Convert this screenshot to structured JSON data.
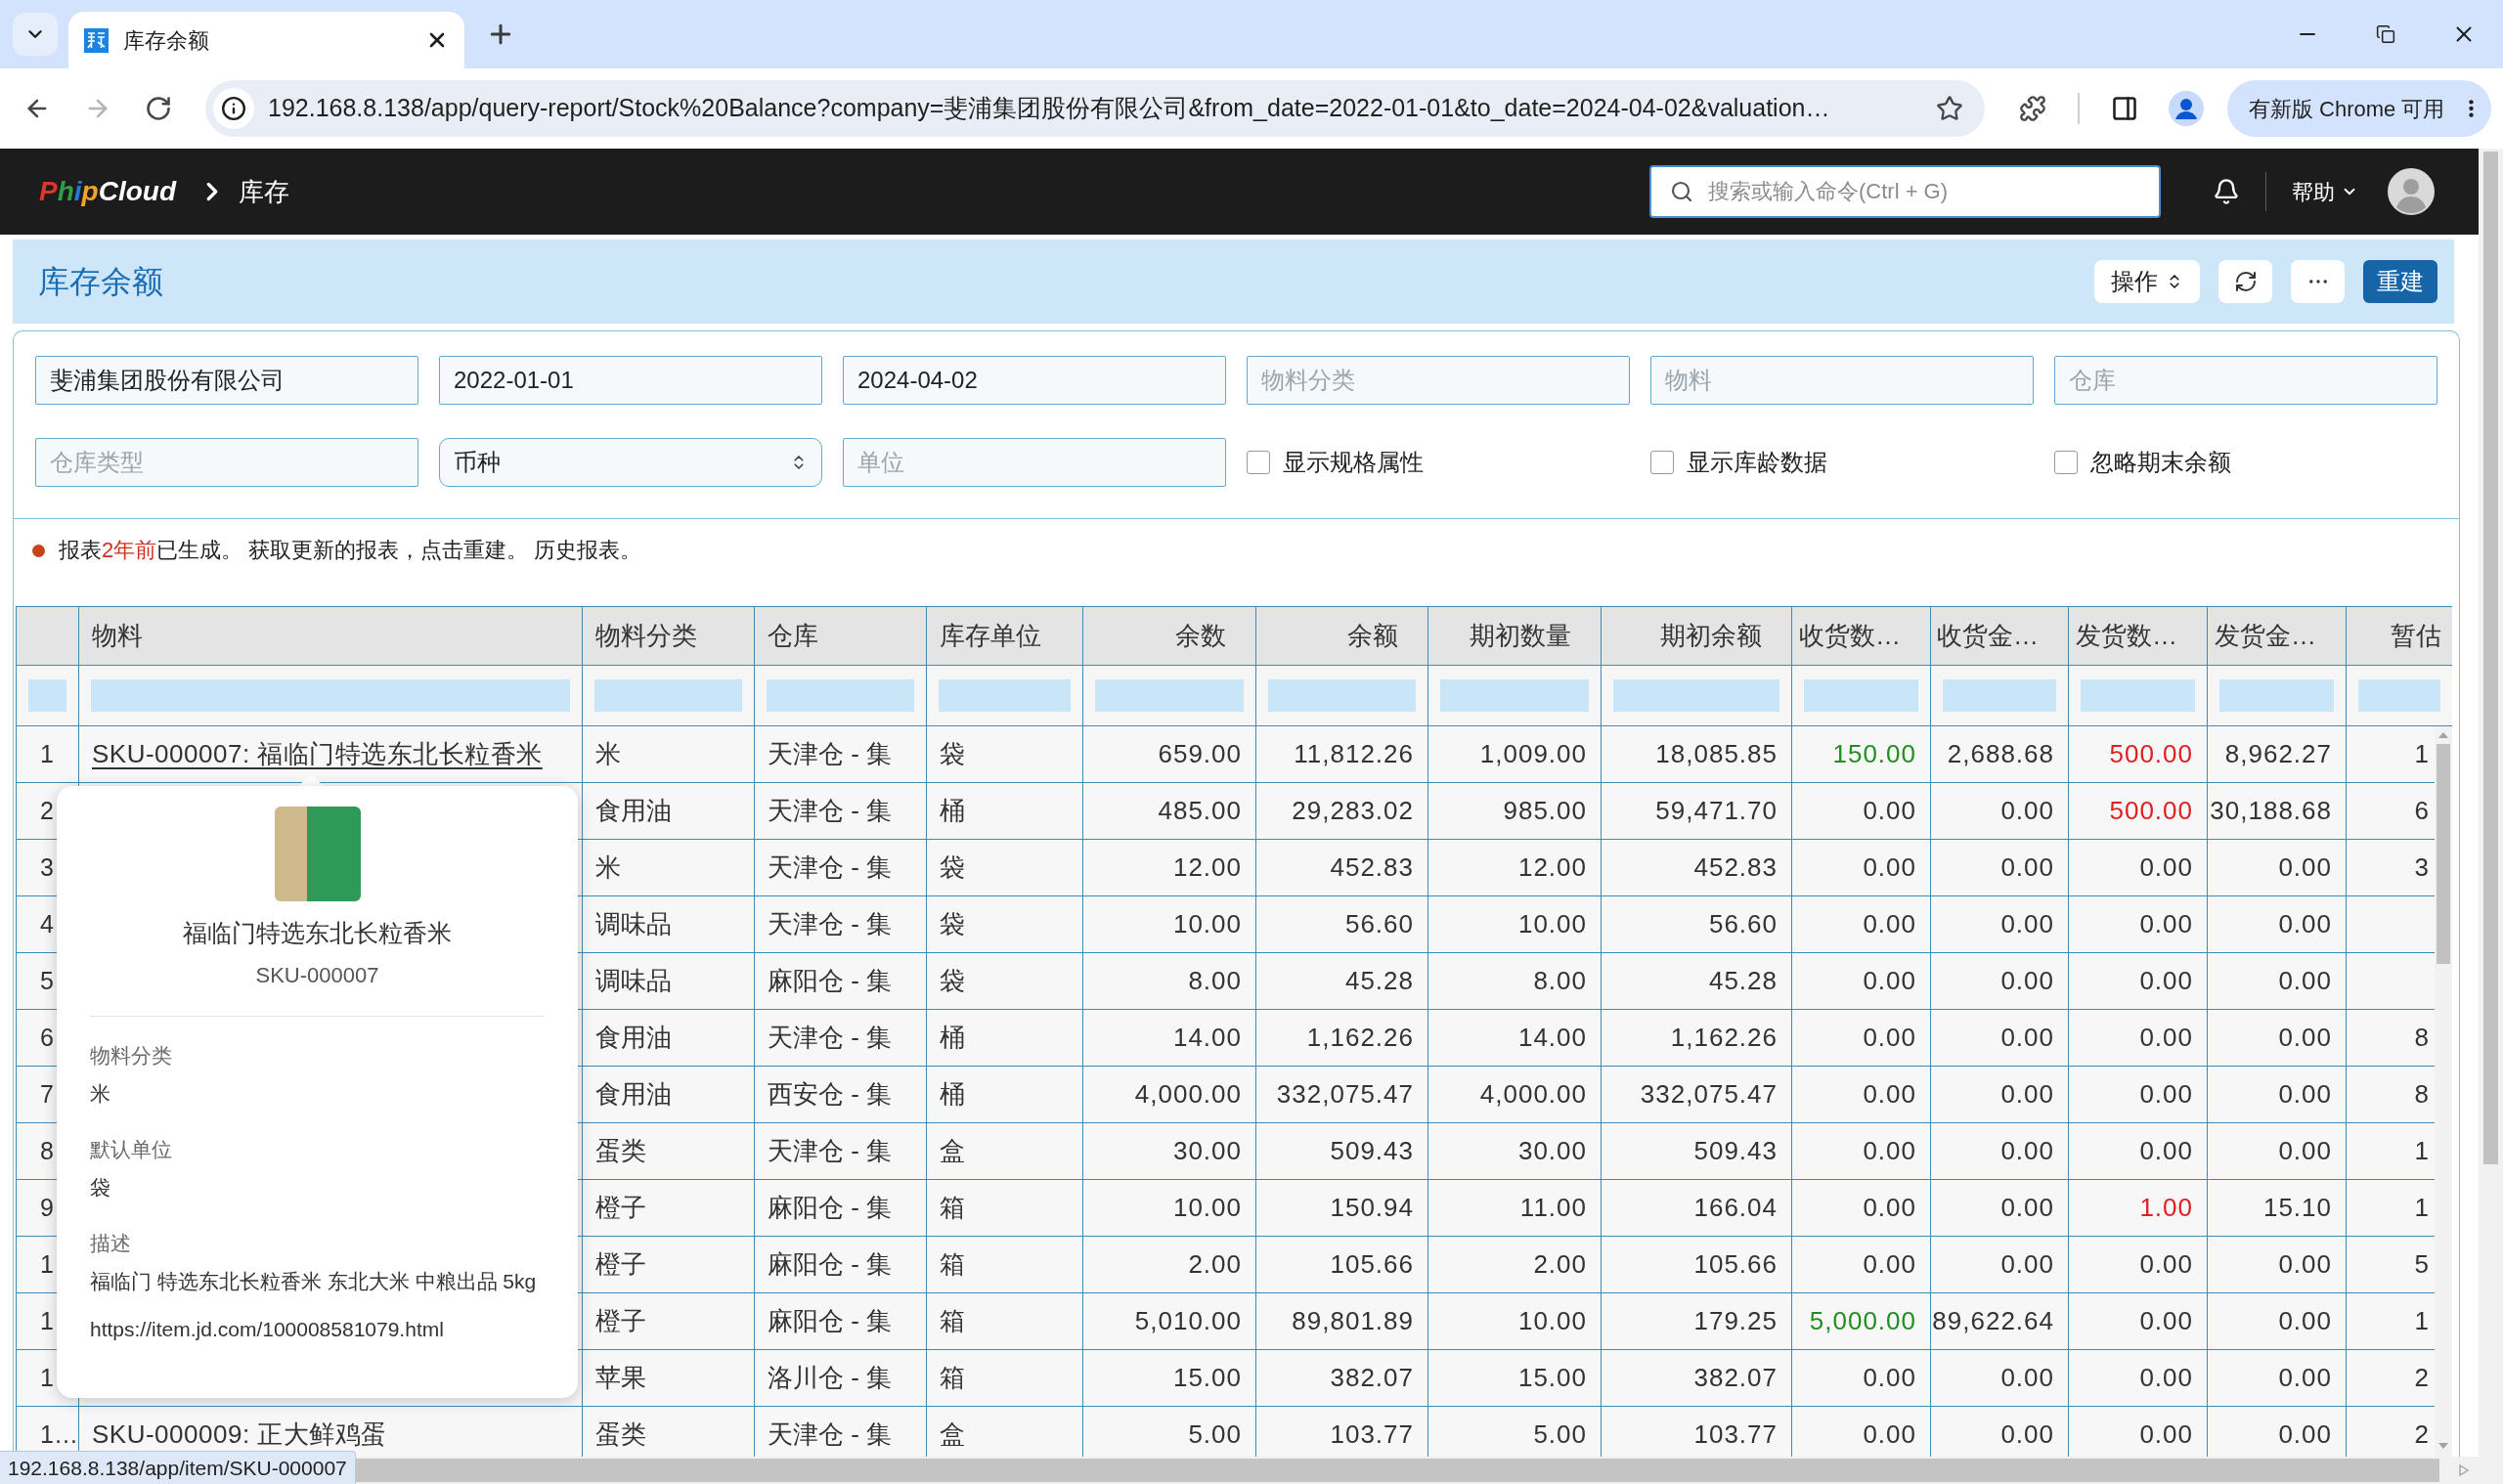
{
  "browser": {
    "tab": {
      "title": "库存余额",
      "selected": true
    },
    "nav_buttons": [
      {
        "kind": "back",
        "disabled": false
      },
      {
        "kind": "forward",
        "disabled": true
      },
      {
        "kind": "reload",
        "disabled": false
      }
    ],
    "url": "192.168.8.138/app/query-report/Stock%20Balance?company=斐浦集团股份有限公司&from_date=2022-01-01&to_date=2024-04-02&valuation…",
    "update_button": "有新版 Chrome 可用"
  },
  "navbar": {
    "logo": [
      {
        "text": "P",
        "color": "#e0352b"
      },
      {
        "text": "h",
        "color": "#2f9e44"
      },
      {
        "text": "i",
        "color": "#2a78d6"
      },
      {
        "text": "p",
        "color": "#f0a52a"
      },
      {
        "text": "Cloud",
        "color": "#ffffff"
      }
    ],
    "breadcrumb": "库存",
    "search": {
      "placeholder": "搜索或输入命令(Ctrl + G)"
    },
    "help": "帮助"
  },
  "page": {
    "title": "库存余额",
    "actions": [
      {
        "kind": "menu",
        "label": "操作"
      },
      {
        "kind": "refresh"
      },
      {
        "kind": "more"
      },
      {
        "kind": "primary",
        "label": "重建"
      }
    ]
  },
  "filters": [
    {
      "kind": "input",
      "value": "斐浦集团股份有限公司"
    },
    {
      "kind": "input",
      "value": "2022-01-01"
    },
    {
      "kind": "input",
      "value": "2024-04-02"
    },
    {
      "kind": "input",
      "placeholder": "物料分类"
    },
    {
      "kind": "input",
      "placeholder": "物料"
    },
    {
      "kind": "input",
      "placeholder": "仓库"
    },
    {
      "kind": "input",
      "placeholder": "仓库类型"
    },
    {
      "kind": "select",
      "value": "币种"
    },
    {
      "kind": "input",
      "placeholder": "单位"
    },
    {
      "kind": "checkbox",
      "label": "显示规格属性",
      "checked": false
    },
    {
      "kind": "checkbox",
      "label": "显示库龄数据",
      "checked": false
    },
    {
      "kind": "checkbox",
      "label": "忽略期末余额",
      "checked": false
    }
  ],
  "message": {
    "before": "报表",
    "time": "2年前",
    "after": "已生成。 获取更新的报表，点击重建。 历史报表。"
  },
  "table": {
    "columns": [
      {
        "label": "物料",
        "kind": "text"
      },
      {
        "label": "物料分类",
        "kind": "text"
      },
      {
        "label": "仓库",
        "kind": "text"
      },
      {
        "label": "库存单位",
        "kind": "text"
      },
      {
        "label": "余数",
        "kind": "number"
      },
      {
        "label": "余额",
        "kind": "number"
      },
      {
        "label": "期初数量",
        "kind": "number"
      },
      {
        "label": "期初余额",
        "kind": "number"
      },
      {
        "label": "收货数…",
        "kind": "number"
      },
      {
        "label": "收货金…",
        "kind": "number"
      },
      {
        "label": "发货数…",
        "kind": "number"
      },
      {
        "label": "发货金…",
        "kind": "number"
      },
      {
        "label": "暂估",
        "kind": "number"
      }
    ],
    "rows": [
      {
        "no": "1",
        "hovered": true,
        "cells": [
          "SKU-000007: 福临门特选东北长粒香米",
          "米",
          "天津仓 - 集",
          "袋",
          "659.00",
          "11,812.26",
          "1,009.00",
          "18,085.85",
          {
            "text": "150.00",
            "color": "#1f8f1f"
          },
          "2,688.68",
          {
            "text": "500.00",
            "color": "#e02020"
          },
          "8,962.27",
          "1"
        ]
      },
      {
        "no": "2",
        "cells": [
          "",
          "食用油",
          "天津仓 - 集",
          "桶",
          "485.00",
          "29,283.02",
          "985.00",
          "59,471.70",
          "0.00",
          "0.00",
          {
            "text": "500.00",
            "color": "#e02020"
          },
          "30,188.68",
          "6"
        ]
      },
      {
        "no": "3",
        "cells": [
          "",
          "米",
          "天津仓 - 集",
          "袋",
          "12.00",
          "452.83",
          "12.00",
          "452.83",
          "0.00",
          "0.00",
          "0.00",
          "0.00",
          "3"
        ]
      },
      {
        "no": "4",
        "cells": [
          "",
          "调味品",
          "天津仓 - 集",
          "袋",
          "10.00",
          "56.60",
          "10.00",
          "56.60",
          "0.00",
          "0.00",
          "0.00",
          "0.00"
        ]
      },
      {
        "no": "5",
        "cells": [
          "",
          "调味品",
          "麻阳仓 - 集",
          "袋",
          "8.00",
          "45.28",
          "8.00",
          "45.28",
          "0.00",
          "0.00",
          "0.00",
          "0.00"
        ]
      },
      {
        "no": "6",
        "cells": [
          "",
          "食用油",
          "天津仓 - 集",
          "桶",
          "14.00",
          "1,162.26",
          "14.00",
          "1,162.26",
          "0.00",
          "0.00",
          "0.00",
          "0.00",
          "8"
        ]
      },
      {
        "no": "7",
        "cells": [
          "",
          "食用油",
          "西安仓 - 集",
          "桶",
          "4,000.00",
          "332,075.47",
          "4,000.00",
          "332,075.47",
          "0.00",
          "0.00",
          "0.00",
          "0.00",
          "8"
        ]
      },
      {
        "no": "8",
        "cells": [
          "",
          "蛋类",
          "天津仓 - 集",
          "盒",
          "30.00",
          "509.43",
          "30.00",
          "509.43",
          "0.00",
          "0.00",
          "0.00",
          "0.00",
          "1"
        ]
      },
      {
        "no": "9",
        "cells": [
          "",
          "橙子",
          "麻阳仓 - 集",
          "箱",
          "10.00",
          "150.94",
          "11.00",
          "166.04",
          "0.00",
          "0.00",
          {
            "text": "1.00",
            "color": "#e02020"
          },
          "15.10",
          "1"
        ]
      },
      {
        "no": "1",
        "cells": [
          "",
          "橙子",
          "麻阳仓 - 集",
          "箱",
          "2.00",
          "105.66",
          "2.00",
          "105.66",
          "0.00",
          "0.00",
          "0.00",
          "0.00",
          "5"
        ]
      },
      {
        "no": "1",
        "cells": [
          "",
          "橙子",
          "麻阳仓 - 集",
          "箱",
          "5,010.00",
          "89,801.89",
          "10.00",
          "179.25",
          {
            "text": "5,000.00",
            "color": "#1f8f1f"
          },
          "89,622.64",
          "0.00",
          "0.00",
          "1"
        ]
      },
      {
        "no": "1",
        "cells": [
          "",
          "苹果",
          "洛川仓 - 集",
          "箱",
          "15.00",
          "382.07",
          "15.00",
          "382.07",
          "0.00",
          "0.00",
          "0.00",
          "0.00",
          "2"
        ]
      },
      {
        "no": "1…",
        "hovered": false,
        "cells": [
          "SKU-000009: 正大鲜鸡蛋",
          "蛋类",
          "天津仓 - 集",
          "盒",
          "5.00",
          "103.77",
          "5.00",
          "103.77",
          "0.00",
          "0.00",
          "0.00",
          "0.00",
          "2"
        ]
      }
    ]
  },
  "popup": {
    "title": "福临门特选东北长粒香米",
    "code": "SKU-000007",
    "fields": [
      {
        "label": "物料分类",
        "value": "米"
      },
      {
        "label": "默认单位",
        "value": "袋"
      },
      {
        "label": "描述",
        "value": "福临门 特选东北长粒香米 东北大米 中粮出品 5kg"
      }
    ],
    "link": "https://item.jd.com/100008581079.html"
  },
  "status_url": "192.168.8.138/app/item/SKU-000007"
}
